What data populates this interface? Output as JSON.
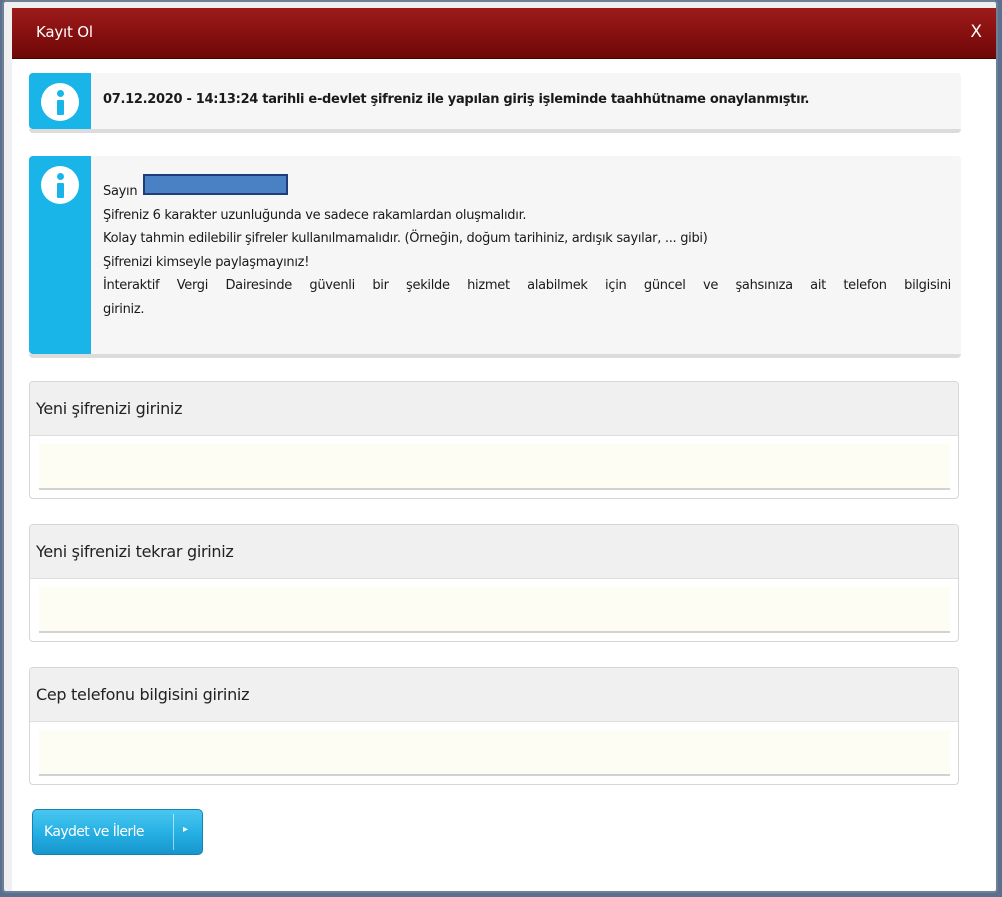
{
  "dialog": {
    "title": "Kayıt Ol",
    "close_label": "X"
  },
  "info_notice": {
    "message": "07.12.2020 - 14:13:24 tarihli e-devlet şifreniz ile yapılan giriş işleminde taahhütname onaylanmıştır."
  },
  "password_rules": {
    "greeting": "Sayın",
    "lines": [
      "Şifreniz 6 karakter uzunluğunda ve sadece rakamlardan oluşmalıdır.",
      "Kolay tahmin edilebilir şifreler kullanılmamalıdır. (Örneğin, doğum tarihiniz, ardışık sayılar, ... gibi)",
      "Şifrenizi kimseyle paylaşmayınız!"
    ],
    "phone_note_line1": "İnteraktif Vergi Dairesinde güvenli bir şekilde hizmet alabilmek için güncel ve şahsınıza ait telefon bilgisini",
    "phone_note_line2": "giriniz."
  },
  "fields": {
    "new_password": {
      "label": "Yeni şifrenizi giriniz",
      "value": ""
    },
    "confirm_password": {
      "label": "Yeni şifrenizi tekrar giriniz",
      "value": ""
    },
    "phone": {
      "label": "Cep telefonu bilgisini giriniz",
      "value": ""
    }
  },
  "actions": {
    "save_label": "Kaydet ve İlerle",
    "save_arrow": "▸"
  },
  "colors": {
    "title_bar": "#8a1111",
    "info_accent": "#1ab5e8",
    "button": "#24aee3",
    "redaction": "#4a80c4"
  }
}
